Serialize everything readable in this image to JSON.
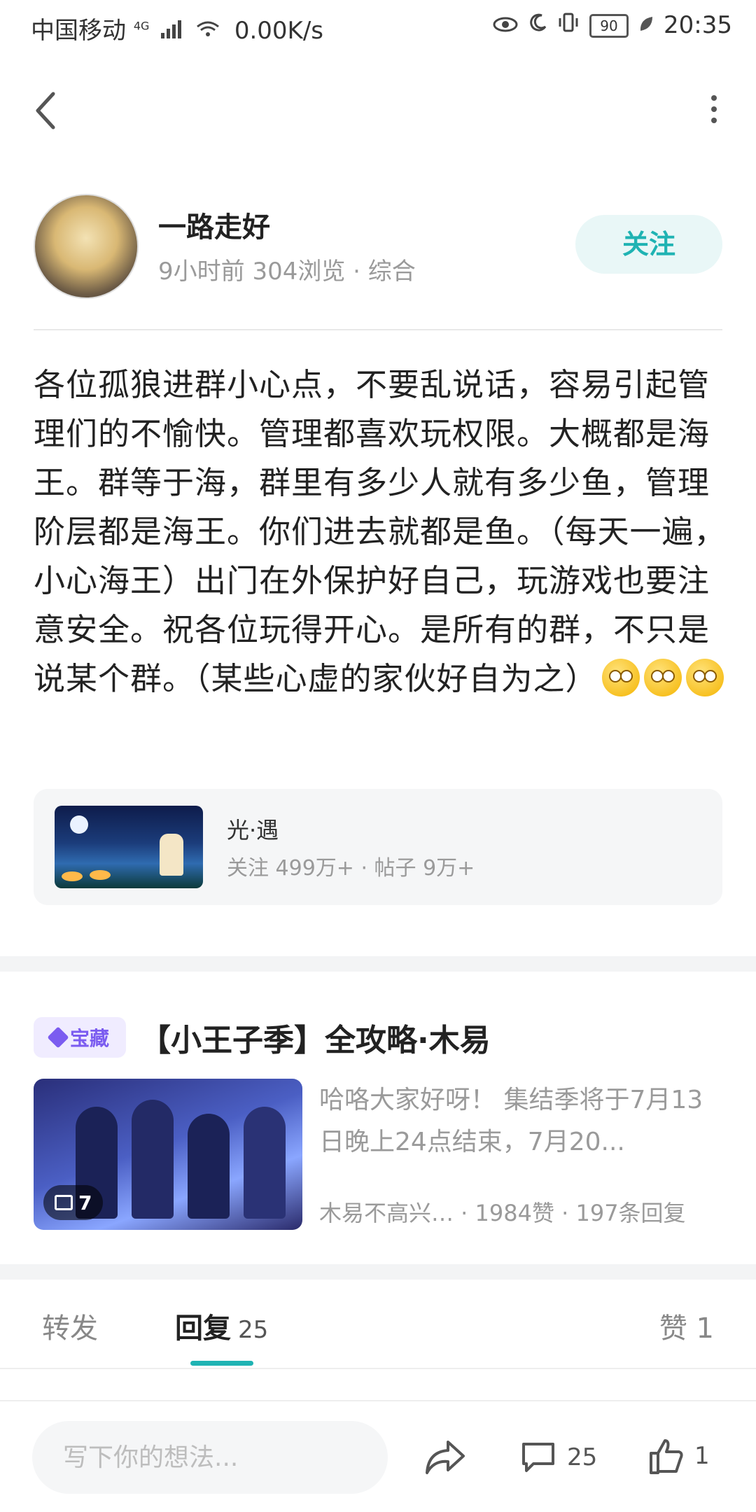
{
  "status_bar": {
    "carrier": "中国移动",
    "network": "4G",
    "speed": "0.00K/s",
    "battery": "90",
    "time": "20:35"
  },
  "author": {
    "name": "一路走好",
    "meta": "9小时前  304浏览 · 综合",
    "follow_label": "关注"
  },
  "post": {
    "body": "各位孤狼进群小心点，不要乱说话，容易引起管理们的不愉快。管理都喜欢玩权限。大概都是海王。群等于海，群里有多少人就有多少鱼，管理阶层都是海王。你们进去就都是鱼。（每天一遍，小心海王）出门在外保护好自己，玩游戏也要注意安全。祝各位玩得开心。是所有的群，不只是说某个群。（某些心虚的家伙好自为之）",
    "emoji_count": 3
  },
  "community": {
    "name": "光·遇",
    "stats": "关注 499万+ · 帖子 9万+"
  },
  "recommended": {
    "badge": "宝藏",
    "title": "【小王子季】全攻略·木易",
    "image_count": "7",
    "description": "哈咯大家好呀！ 集结季将于7月13日晚上24点结束，7月20...",
    "meta": "木易不高兴…  · 1984赞 · 197条回复"
  },
  "tabs": {
    "forward": "转发",
    "reply": "回复",
    "reply_count": "25",
    "like": "赞 1"
  },
  "bottom_bar": {
    "input_placeholder": "写下你的想法...",
    "comments_count": "25",
    "likes_count": "1"
  },
  "colors": {
    "accent": "#1fb3b3",
    "badge": "#7b5cf0",
    "muted_text": "#9a9a9a"
  }
}
